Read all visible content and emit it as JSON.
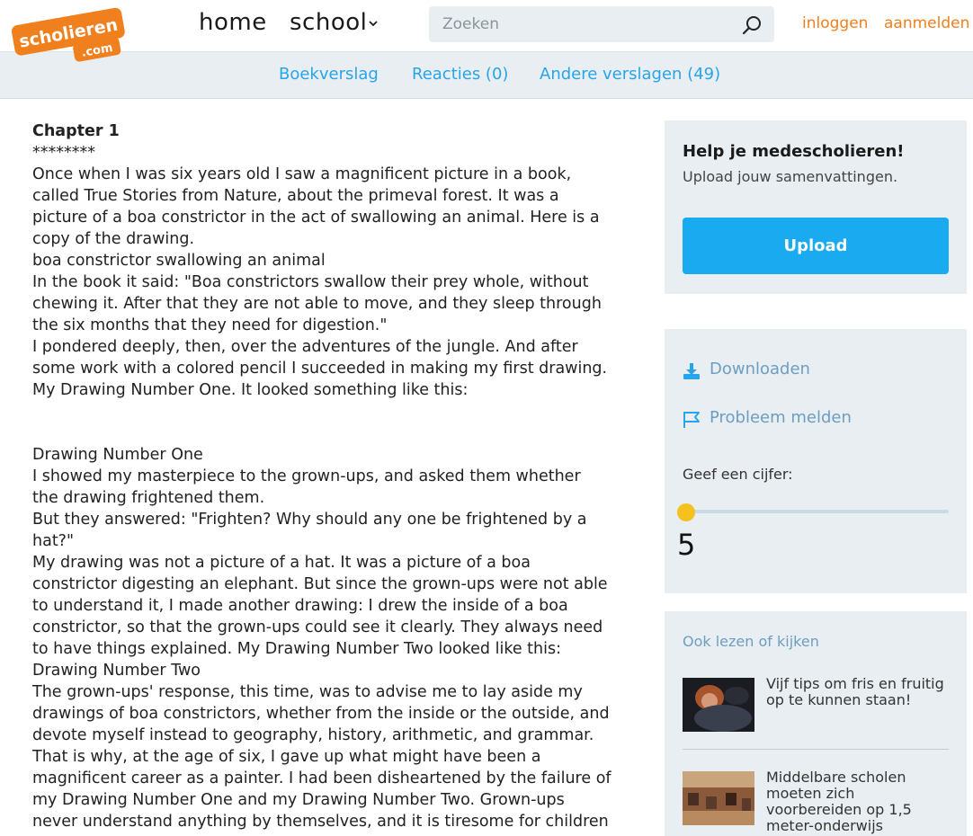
{
  "header": {
    "logo_main": "scholieren",
    "logo_sub": ".com",
    "nav": {
      "home": "home",
      "school": "school"
    },
    "search": {
      "placeholder": "Zoeken",
      "value": ""
    },
    "auth": {
      "login": "inloggen",
      "register": "aanmelden"
    }
  },
  "subnav": {
    "items": [
      "Boekverslag",
      "Reacties (0)",
      "Andere verslagen (49)"
    ]
  },
  "article": {
    "heading": "Chapter 1",
    "lines": [
      "********",
      "Once when I was six years old I saw a magnificent picture in a book,",
      "called True Stories from Nature, about the primeval forest. It was a",
      "picture of a boa constrictor in the act of swallowing an animal. Here is a",
      "copy of the drawing.",
      "boa constrictor swallowing an animal",
      "In the book it said: \"Boa constrictors swallow their prey whole, without",
      "chewing it. After that they are not able to move, and they sleep through",
      "the six months that they need for digestion.\"",
      "I pondered deeply, then, over the adventures of the jungle. And after",
      "some work with a colored pencil I succeeded in making my first drawing.",
      "My Drawing Number One. It looked something like this:"
    ],
    "lines_after": [
      "Drawing Number One",
      "I showed my masterpiece to the grown-ups, and asked them whether",
      "the drawing frightened them.",
      "But they answered: \"Frighten? Why should any one be frightened by a",
      "hat?\"",
      "My drawing was not a picture of a hat. It was a picture of a boa",
      "constrictor digesting an elephant. But since the grown-ups were not able",
      "to understand it, I made another drawing: I drew the inside of a boa",
      "constrictor, so that the grown-ups could see it clearly. They always need",
      "to have things explained. My Drawing Number Two looked like this:",
      "Drawing Number Two",
      "The grown-ups' response, this time, was to advise me to lay aside my",
      "drawings of boa constrictors, whether from the inside or the outside, and",
      "devote myself instead to geography, history, arithmetic, and grammar.",
      "That is why, at the age of six, I gave up what might have been a",
      "magnificent career as a painter. I had been disheartened by the failure of",
      "my Drawing Number One and my Drawing Number Two. Grown-ups",
      "never understand anything by themselves, and it is tiresome for children"
    ]
  },
  "sidebar": {
    "help": {
      "title": "Help je medescholieren!",
      "subtitle": "Upload jouw samenvattingen.",
      "button": "Upload"
    },
    "actions": {
      "download": "Downloaden",
      "report": "Probleem melden",
      "rate_label": "Geef een cijfer:",
      "rating": "5"
    },
    "also": {
      "title": "Ook lezen of kijken",
      "items": [
        "Vijf tips om fris en fruitig op te kunnen staan!",
        "Middelbare scholen moeten zich voorbereiden op 1,5 meter-onderwijs"
      ]
    }
  },
  "colors": {
    "accent_orange": "#f07f1d",
    "link_blue": "#28a4e8",
    "button_blue": "#19aaf0",
    "panel_grey": "#e9eef2",
    "slider_knob": "#f5c11f"
  }
}
